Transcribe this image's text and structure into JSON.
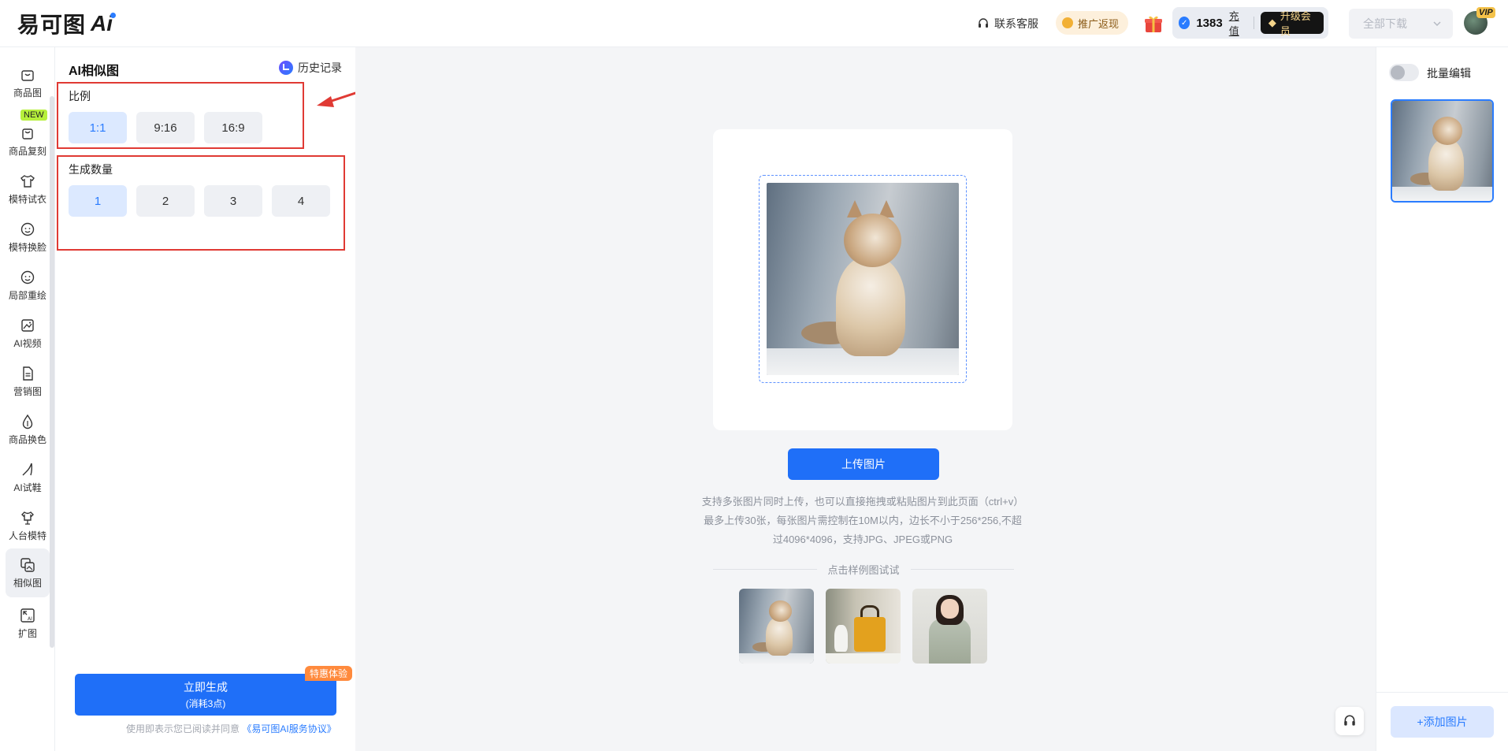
{
  "header": {
    "logo_text": "易可图",
    "logo_ai": "Ai",
    "support_label": "联系客服",
    "promo_label": "推广返现",
    "credits": "1383",
    "recharge_label": "充值",
    "upgrade_label": "升级会员",
    "download_label": "全部下载",
    "vip_label": "VIP"
  },
  "sidebar": {
    "new_badge": "NEW",
    "items": [
      {
        "label": "商品图",
        "icon": "bag-icon"
      },
      {
        "label": "商品复刻",
        "icon": "copy-bag-icon"
      },
      {
        "label": "模特试衣",
        "icon": "shirt-icon"
      },
      {
        "label": "模特换脸",
        "icon": "face-icon"
      },
      {
        "label": "局部重绘",
        "icon": "face-edit-icon"
      },
      {
        "label": "AI视频",
        "icon": "video-icon"
      },
      {
        "label": "营销图",
        "icon": "document-icon"
      },
      {
        "label": "商品换色",
        "icon": "drop-icon"
      },
      {
        "label": "AI试鞋",
        "icon": "shoe-icon"
      },
      {
        "label": "人台模特",
        "icon": "mannequin-icon"
      },
      {
        "label": "相似图",
        "icon": "similar-image-icon"
      },
      {
        "label": "扩图",
        "icon": "expand-icon"
      }
    ]
  },
  "panel": {
    "title": "AI相似图",
    "history_label": "历史记录",
    "ratio": {
      "label": "比例",
      "options": [
        "1:1",
        "9:16",
        "16:9"
      ],
      "selected": "1:1"
    },
    "count": {
      "label": "生成数量",
      "options": [
        "1",
        "2",
        "3",
        "4"
      ],
      "selected": "1"
    },
    "generate": {
      "label": "立即生成",
      "cost": "(消耗3点)",
      "tag": "特惠体验"
    },
    "agreement_prefix": "使用即表示您已阅读并同意",
    "agreement_link": "《易可图AI服务协议》"
  },
  "main": {
    "upload_label": "上传图片",
    "hint_lines": [
      "支持多张图片同时上传，也可以直接拖拽或粘贴图片到此页面（ctrl+v）",
      "最多上传30张，每张图片需控制在10M以内，边长不小于256*256,不超",
      "过4096*4096，支持JPG、JPEG或PNG"
    ],
    "samples_label": "点击样例图试试"
  },
  "right_panel": {
    "batch_edit_label": "批量编辑",
    "add_image_label": "+添加图片"
  },
  "colors": {
    "primary": "#1f6ff8",
    "annotation_red": "#e03a34",
    "selected_bg": "#dce9ff",
    "promo_bg": "#fdf0dc"
  }
}
